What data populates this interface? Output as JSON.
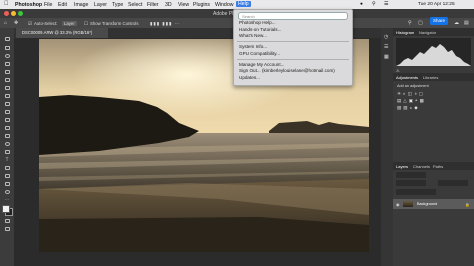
{
  "menubar": {
    "app_name": "Photoshop",
    "items": [
      "File",
      "Edit",
      "Image",
      "Layer",
      "Type",
      "Select",
      "Filter",
      "3D",
      "View",
      "Plugins",
      "Window",
      "Help"
    ],
    "clock": "Tue 20 Apr 12:25"
  },
  "window": {
    "title": "Adobe Ph",
    "share_label": "Share"
  },
  "options": {
    "auto_select_label": "Auto-Select:",
    "auto_select_value": "Layer",
    "show_transform_label": "Show Transform Controls"
  },
  "document": {
    "tab_label": "DSC00009.ARW @ 33.3% (RGB/16*)"
  },
  "help_menu": {
    "search_placeholder": "Search",
    "items_group1": [
      "Photoshop Help...",
      "Hands-on Tutorials...",
      "What's New..."
    ],
    "items_group2": [
      "System Info...",
      "GPU Compatibility..."
    ],
    "items_group3": [
      "Manage My Account...",
      "Sign Out... (kimberleylouiselane@hotmail.com)",
      "Updates..."
    ]
  },
  "panels": {
    "histogram_tabs": [
      "Histogram",
      "Navigator"
    ],
    "adjustment_tabs": [
      "Adjustments",
      "Libraries"
    ],
    "adjustments_hint": "Add an adjustment",
    "layers_tabs": [
      "Layers",
      "Channels",
      "Paths"
    ],
    "background_layer": "Background"
  },
  "colors": {
    "accent": "#1473e6",
    "menu_highlight": "#3b7de6",
    "canvas_bg": "#2b2b2b"
  }
}
